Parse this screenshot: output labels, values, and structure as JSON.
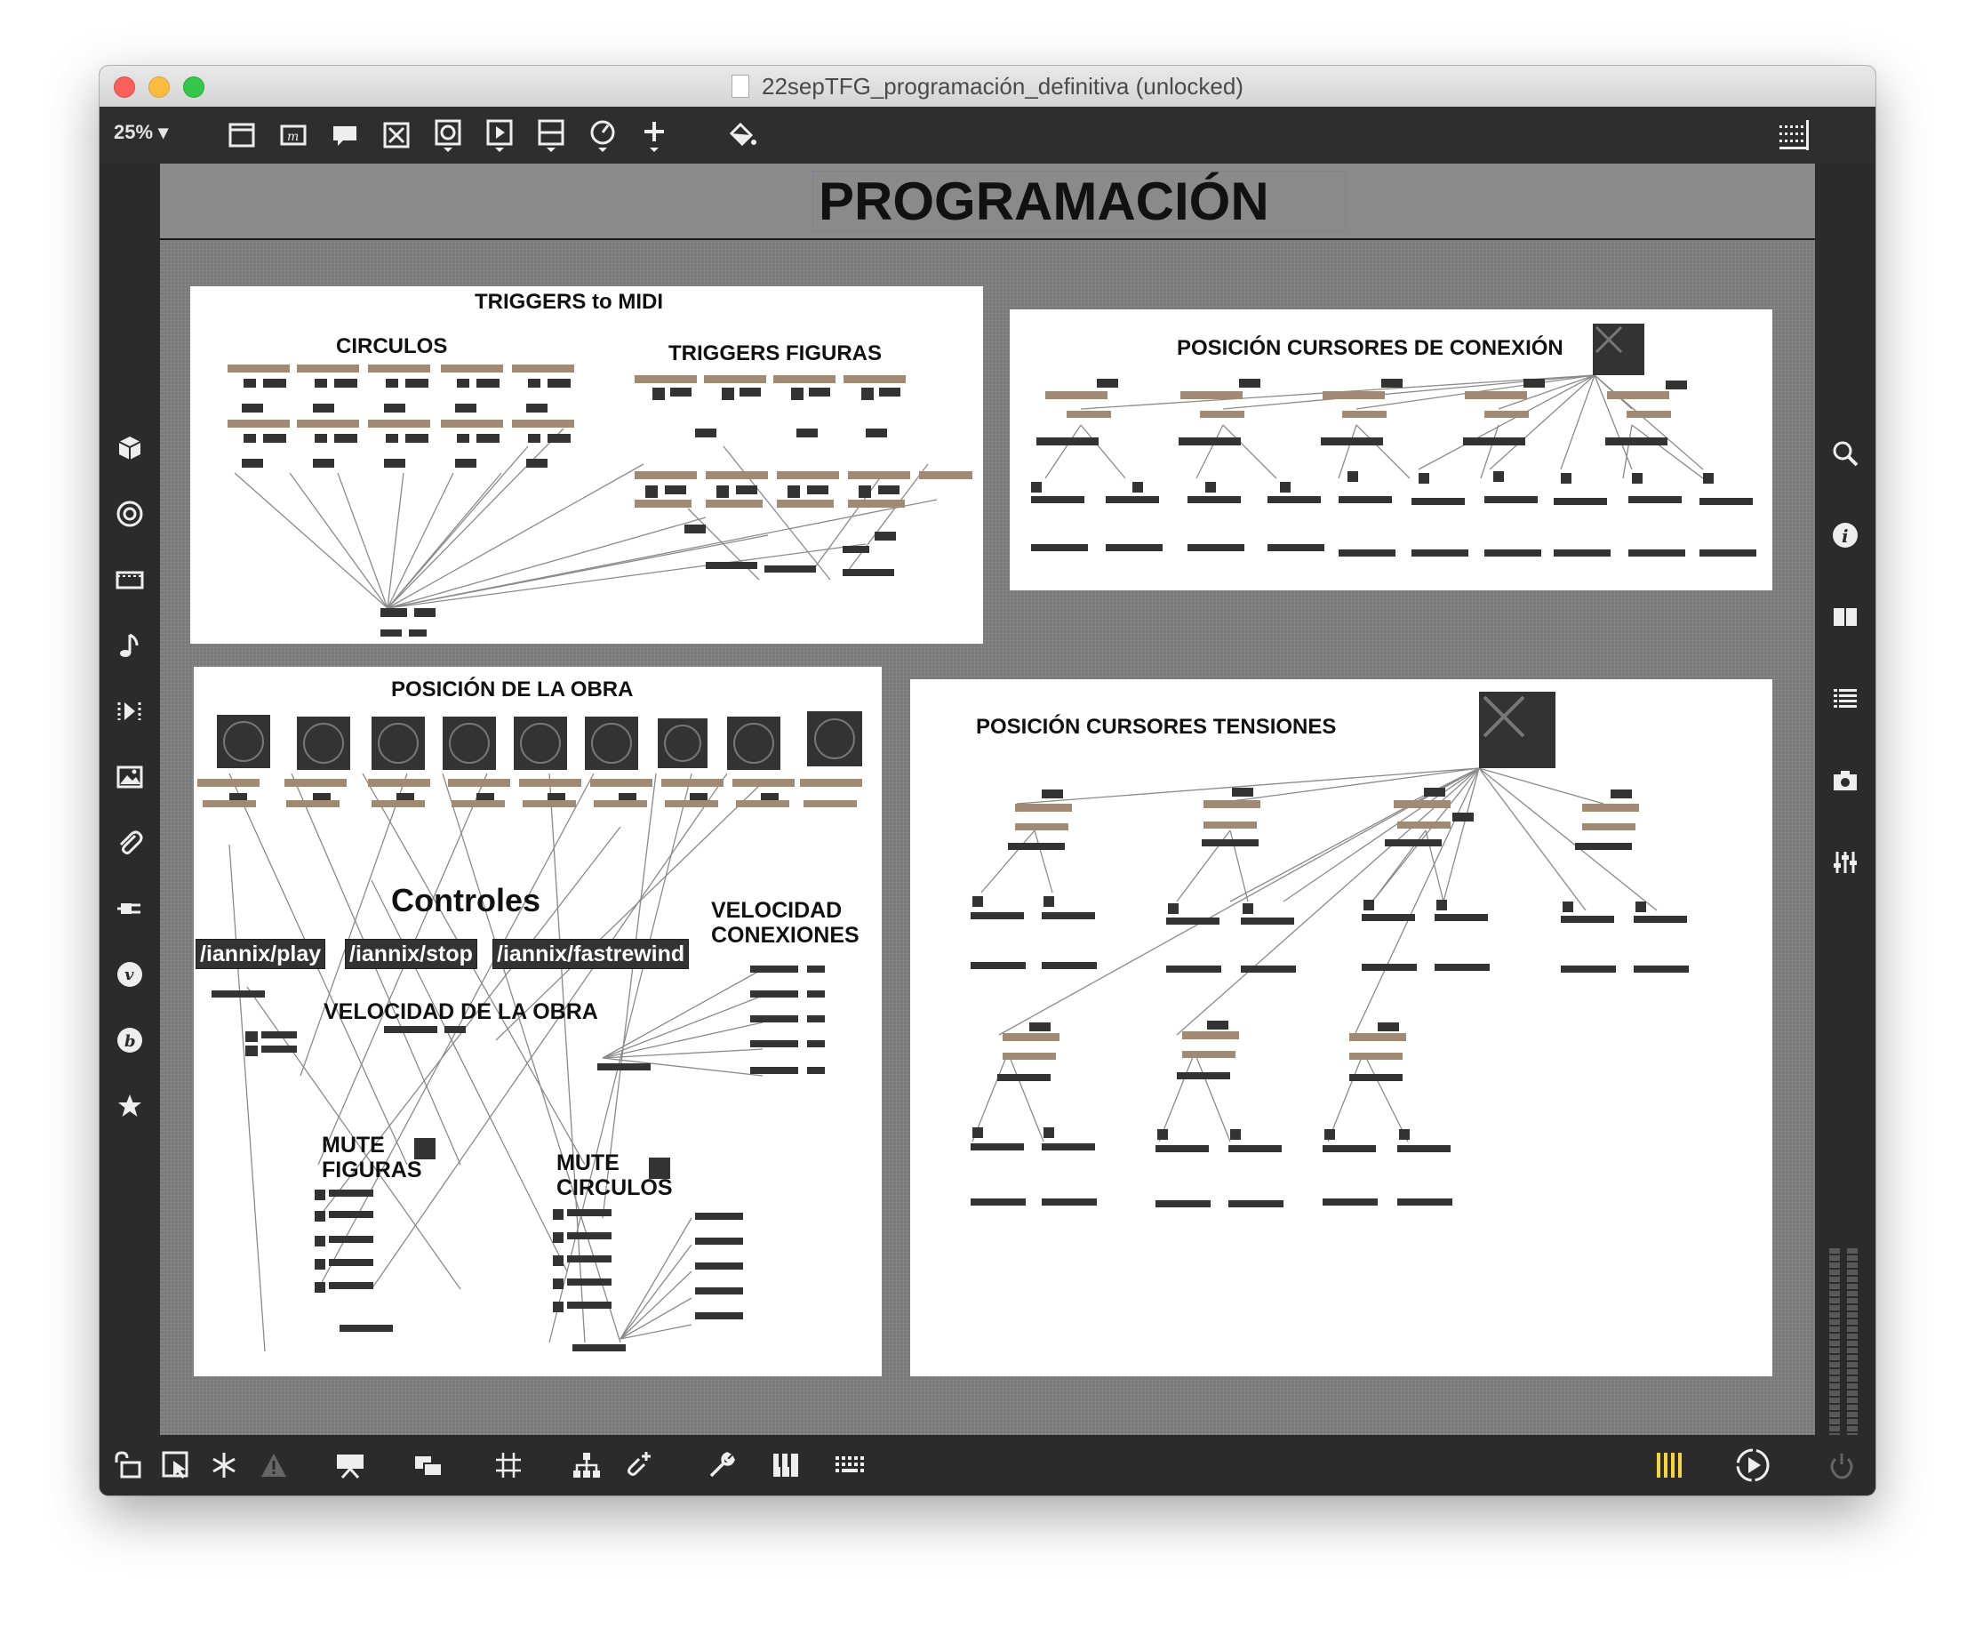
{
  "window": {
    "title": "22sepTFG_programación_definitiva (unlocked)"
  },
  "toolbar": {
    "zoom": "25%"
  },
  "page_title": "PROGRAMACIÓN",
  "panels": {
    "triggers": {
      "title": "TRIGGERS to MIDI",
      "circulos": "CIRCULOS",
      "figuras": "TRIGGERS FIGURAS"
    },
    "conexion": {
      "title": "POSICIÓN CURSORES DE CONEXIÓN"
    },
    "obra": {
      "title": "POSICIÓN DE LA OBRA",
      "controles": "Controles",
      "buttons": [
        "/iannix/play",
        "/iannix/stop",
        "/iannix/fastrewind"
      ],
      "velocidad_conexiones": [
        "VELOCIDAD",
        "CONEXIONES"
      ],
      "velocidad_obra": "VELOCIDAD DE LA OBRA",
      "mute_figuras": [
        "MUTE",
        "FIGURAS"
      ],
      "mute_circulos": [
        "MUTE",
        "CIRCULOS"
      ]
    },
    "tensiones": {
      "title": "POSICIÓN CURSORES TENSIONES"
    }
  },
  "colors": {
    "accent": "#f5d33a",
    "object_box": "#a08a74",
    "dark_box": "#333333"
  }
}
